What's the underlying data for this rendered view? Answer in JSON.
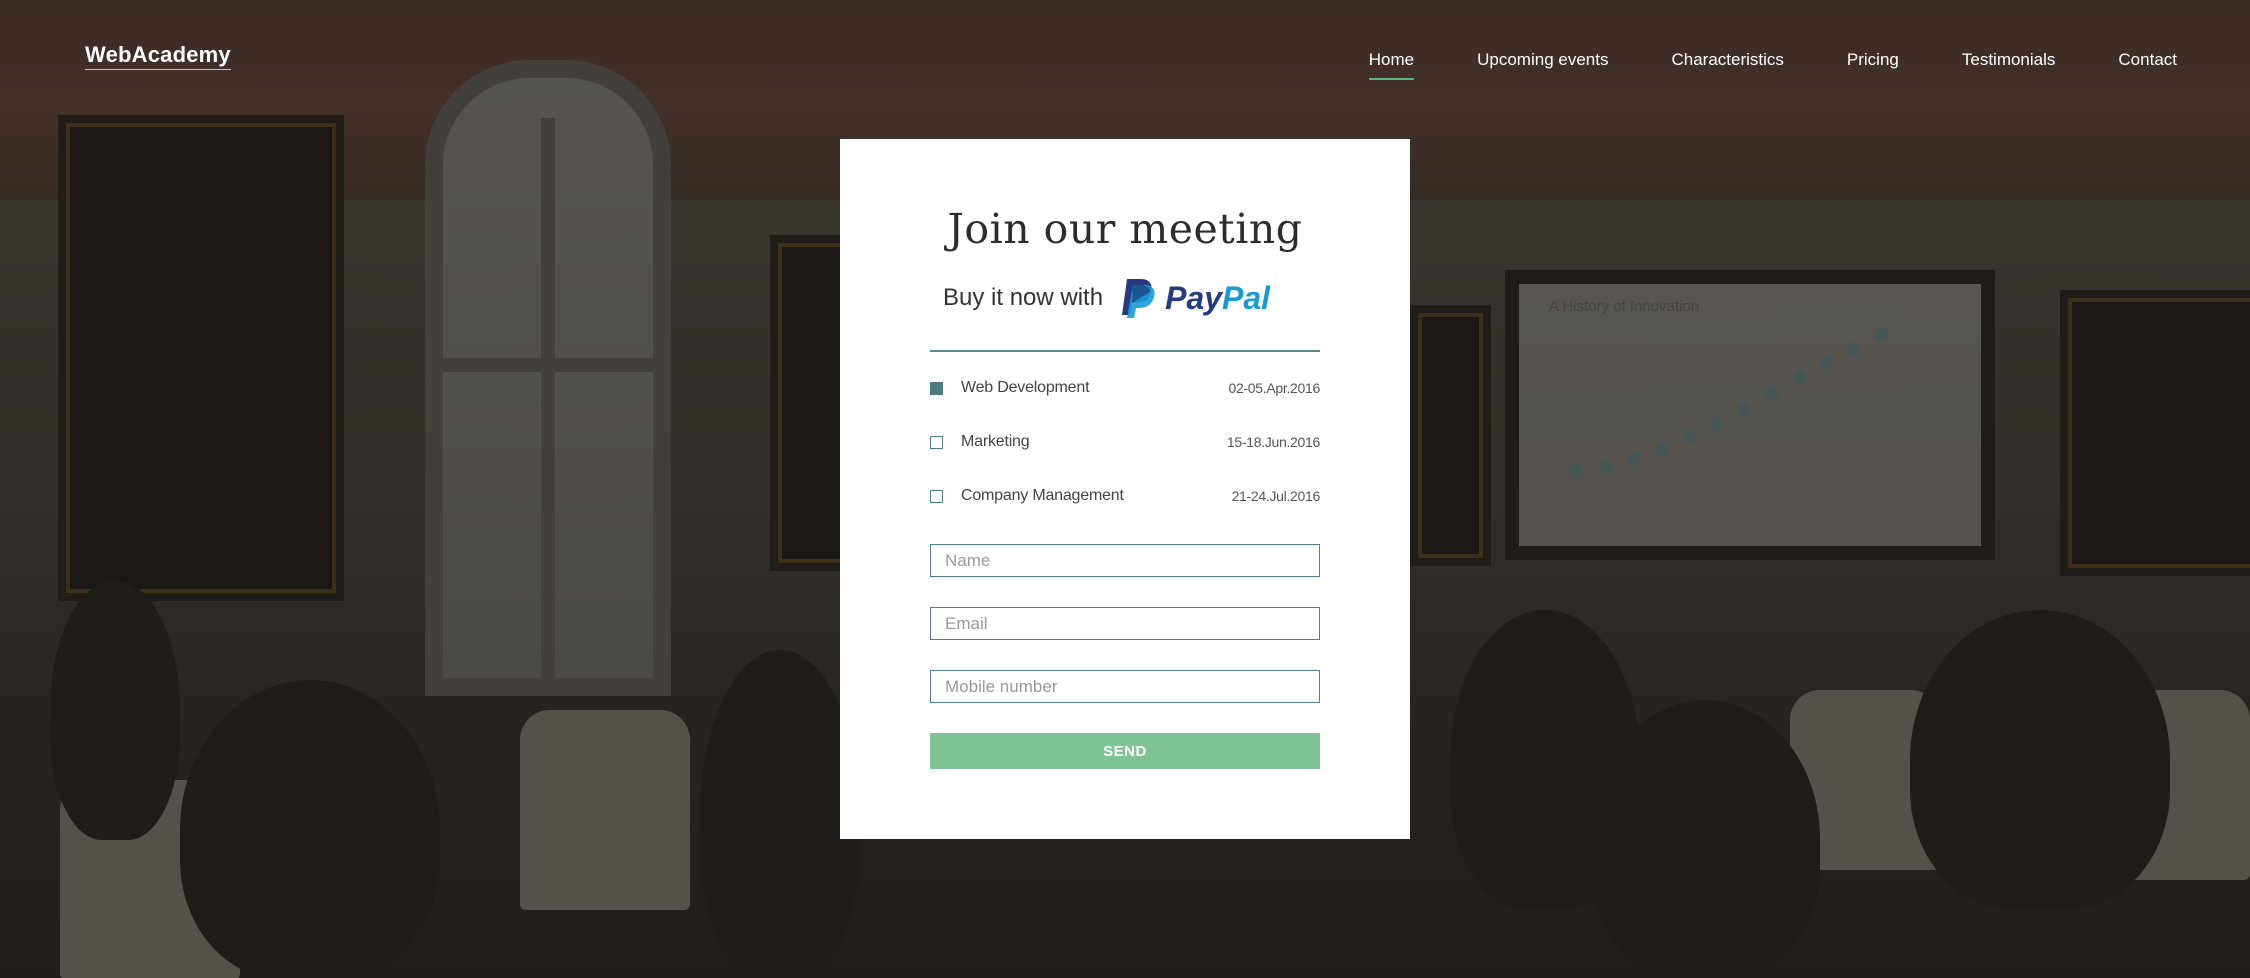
{
  "header": {
    "logo": "WebAcademy",
    "nav": [
      {
        "label": "Home",
        "active": true
      },
      {
        "label": "Upcoming events",
        "active": false
      },
      {
        "label": "Characteristics",
        "active": false
      },
      {
        "label": "Pricing",
        "active": false
      },
      {
        "label": "Testimonials",
        "active": false
      },
      {
        "label": "Contact",
        "active": false
      }
    ]
  },
  "card": {
    "title": "Join our meeting",
    "buy_text": "Buy it now with",
    "paypal": {
      "pay": "Pay",
      "pal": "Pal"
    },
    "events": [
      {
        "name": "Web Development",
        "date": "02-05.Apr.2016",
        "checked": true
      },
      {
        "name": "Marketing",
        "date": "15-18.Jun.2016",
        "checked": false
      },
      {
        "name": "Company Management",
        "date": "21-24.Jul.2016",
        "checked": false
      }
    ],
    "fields": {
      "name_placeholder": "Name",
      "email_placeholder": "Email",
      "mobile_placeholder": "Mobile number"
    },
    "send_label": "SEND"
  },
  "background": {
    "screen_text": "A History of Innovation"
  },
  "colors": {
    "accent": "#5fb37a",
    "button": "#7fc495",
    "border": "#4d8187",
    "paypal_dark": "#253b80",
    "paypal_light": "#179bd7"
  }
}
